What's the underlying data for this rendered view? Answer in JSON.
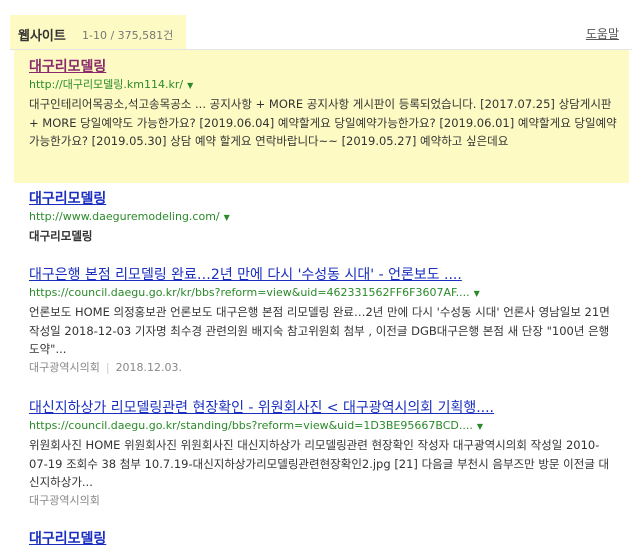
{
  "header": {
    "title": "웹사이트",
    "count": "1-10 / 375,581건",
    "help": "도움말"
  },
  "results": [
    {
      "title": "대구리모델링",
      "url": "http://대구리모델링.km114.kr/",
      "snippet": "대구인테리어목공소,석고송목공소 ... 공지사항 + MORE 공지사항 게시판이 등록되었습니다. [2017.07.25] 상담게시판 + MORE 당일예약도 가능한가요? [2019.06.04] 예약할게요 당일예약가능한가요? [2019.06.01] 예약할게요 당일예약가능한가요? [2019.05.30] 상담 예약 할게요 연락바랍니다~~ [2019.05.27] 예약하고 싶은데요"
    },
    {
      "title": "대구리모델링",
      "url": "http://www.daeguremodeling.com/",
      "snippet": "대구리모델링"
    },
    {
      "title": "대구은행 본점 리모델링 완료…2년 만에 다시 '수성동 시대' - 언론보도 ....",
      "url": "https://council.daegu.go.kr/kr/bbs?reform=view&uid=462331562FF6F3607AF....",
      "snippet": "언론보도 HOME 의정홍보관 언론보도 대구은행 본점 리모델링 완료…2년 만에 다시 '수성동 시대' 언론사 영남일보 21면 작성일 2018-12-03 기자명 최수경 관련의원 배지숙 참고위원회 첨부 , 이전글 DGB대구은행 본점 새 단장 \"100년 은행 도약\"...",
      "source": "대구광역시의회",
      "date": "2018.12.03."
    },
    {
      "title": "대신지하상가 리모델링관련 현장확인 - 위원회사진 < 대구광역시의회 기획행....",
      "url": "https://council.daegu.go.kr/standing/bbs?reform=view&uid=1D3BE95667BCD....",
      "snippet": "위원회사진 HOME 위원회사진 위원회사진 대신지하상가 리모델링관련 현장확인 작성자 대구광역시의회 작성일 2010-07-19 조회수 38 첨부 10.7.19-대신지하상가리모델링관련현장확인2.jpg [21] 다음글 부천시 음부즈만 방문 이전글 대신지하상가...",
      "source": "대구광역시의회"
    },
    {
      "title": "대구리모델링"
    }
  ]
}
